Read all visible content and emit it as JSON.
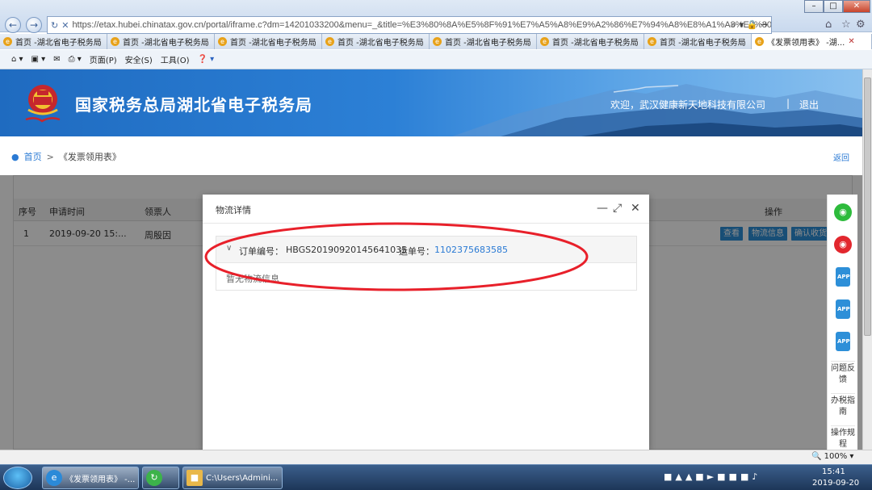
{
  "browser": {
    "url": "https://etax.hubei.chinatax.gov.cn/portal/iframe.c?dm=14201033200&menu=_&title=%E3%80%8A%E5%8F%91%E7%A5%A8%E9%A2%86%E7%94%A8%E8%A1%A8%E3%80%8B&gc",
    "tabs": [
      {
        "label": "首页 -湖北省电子税务局",
        "active": false
      },
      {
        "label": "首页 -湖北省电子税务局",
        "active": false
      },
      {
        "label": "首页 -湖北省电子税务局",
        "active": false
      },
      {
        "label": "首页 -湖北省电子税务局",
        "active": false
      },
      {
        "label": "首页 -湖北省电子税务局",
        "active": false
      },
      {
        "label": "首页 -湖北省电子税务局",
        "active": false
      },
      {
        "label": "首页 -湖北省电子税务局",
        "active": false
      },
      {
        "label": "《发票领用表》 -湖...",
        "active": true
      }
    ],
    "command_bar": {
      "page_menu": "页面(P)",
      "safety_menu": "安全(S)",
      "tools_menu": "工具(O)"
    },
    "zoom": "100%"
  },
  "site": {
    "title": "国家税务总局湖北省电子税务局",
    "welcome": "欢迎，武汉健康新天地科技有限公司",
    "separator": "|",
    "logout": "退出"
  },
  "breadcrumb": {
    "home": "首页",
    "separator": ">",
    "current": "《发票领用表》",
    "back": "返回"
  },
  "table": {
    "headers": {
      "seq": "序号",
      "apply_time": "申请时间",
      "recipient": "领票人",
      "operation": "操作"
    },
    "rows": [
      {
        "seq": "1",
        "apply_time": "2019-09-20 15:...",
        "recipient": "周殷因"
      }
    ],
    "actions": {
      "view": "查看",
      "logistics": "物流信息",
      "confirm": "确认收货"
    }
  },
  "modal": {
    "title": "物流详情",
    "order_label": "订单编号：",
    "order_no": "HBGS20190920145641035",
    "waybill_label": "运单号：",
    "waybill_no": "1102375683585",
    "empty_message": "暂无物流信息"
  },
  "side_toolbar": {
    "app_label": "APP",
    "feedback": "问题反馈",
    "guide": "办税指南",
    "rules": "操作规程"
  },
  "taskbar": {
    "ie_task": "《发票领用表》 -...",
    "explorer_task": "C:\\Users\\Admini...",
    "time": "15:41",
    "date": "2019-09-20"
  },
  "colors": {
    "accent_blue": "#2d8fd8",
    "header_blue": "#1f6bc0",
    "annotation_red": "#e8202a"
  }
}
